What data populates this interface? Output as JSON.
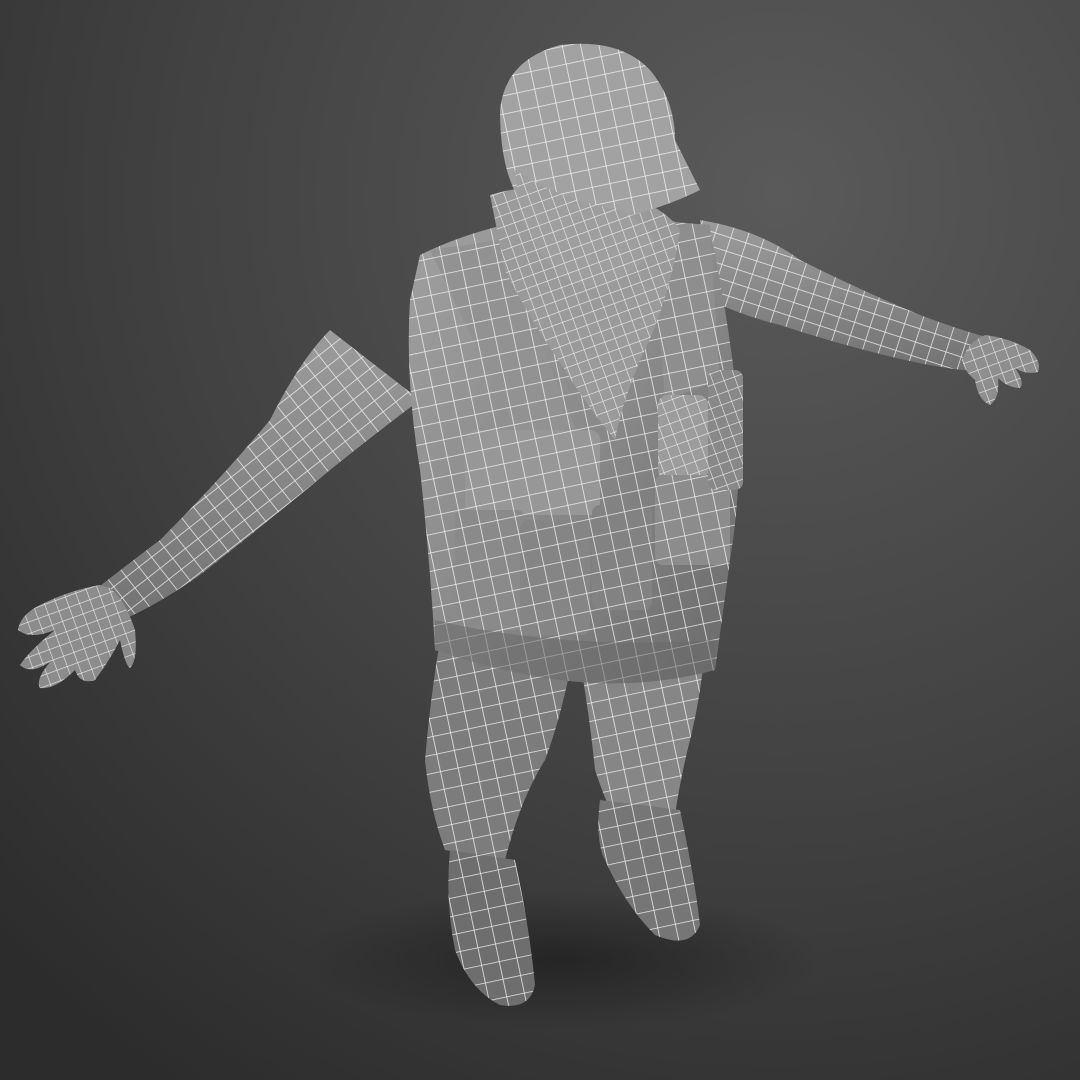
{
  "scene": {
    "subject": "wireframe-soldier-model",
    "colors": {
      "background_light": "#5a5a5a",
      "background_dark": "#2c2c2c",
      "model_fill": "#8a8a8a",
      "model_shadow": "#5e5e5e",
      "model_highlight": "#a6a6a6",
      "wire": "#f4f4f4",
      "ground_shadow": "#1e1e1e"
    }
  }
}
